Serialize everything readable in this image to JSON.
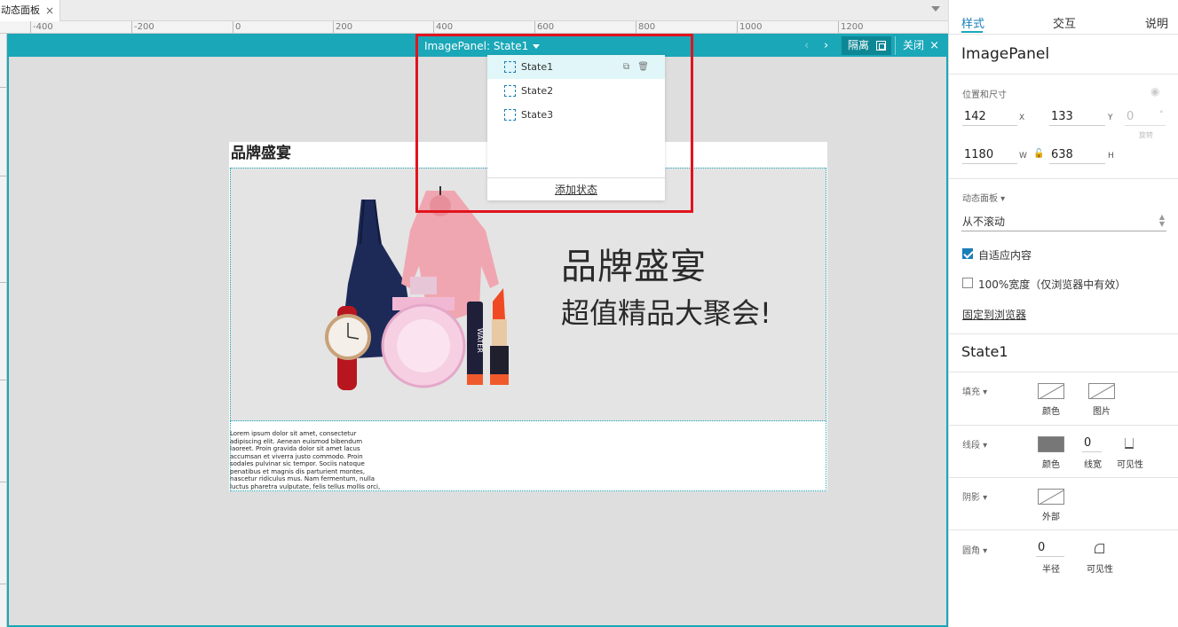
{
  "tab": {
    "label": "动态面板",
    "close": "×"
  },
  "ruler": {
    "ticks": [
      "-400",
      "-200",
      "0",
      "200",
      "400",
      "600",
      "800",
      "1000",
      "1200"
    ]
  },
  "panel": {
    "name_label": "ImagePanel:",
    "state": "State1",
    "prev": "‹",
    "next": "›",
    "isolate": "隔离",
    "close": "关闭",
    "close_x": "×"
  },
  "dropdown": {
    "states": [
      "State1",
      "State2",
      "State3"
    ],
    "add_state": "添加状态"
  },
  "design": {
    "title": "品牌盛宴",
    "headline": "品牌盛宴",
    "subline": "超值精品大聚会!",
    "lorem": "Lorem ipsum dolor sit amet, consectetur adipiscing elit. Aenean euismod bibendum laoreet. Proin gravida dolor sit amet lacus accumsan et viverra justo commodo. Proin sodales pulvinar sic tempor. Sociis natoque penatibus et magnis dis parturient montes, nascetur ridiculus mus. Nam fermentum, nulla luctus pharetra vulputate, felis tellus mollis orci, sed rhoncus pronin sapien nunc accuan eget.",
    "lipstick_text": "WATER"
  },
  "inspector": {
    "tabs": [
      "样式",
      "交互",
      "说明"
    ],
    "element_name": "ImagePanel",
    "pos_size_label": "位置和尺寸",
    "x": "142",
    "x_unit": "X",
    "y": "133",
    "y_unit": "Y",
    "rotation": "0",
    "rotation_unit": "°",
    "rotation_label": "旋转",
    "w": "1180",
    "w_unit": "W",
    "h": "638",
    "h_unit": "H",
    "dynamic_panel_label": "动态面板",
    "scroll_value": "从不滚动",
    "fit_content": "自适应内容",
    "full_width": "100%宽度（仅浏览器中有效）",
    "pin_browser": "固定到浏览器",
    "state_name": "State1",
    "fill_label": "填充",
    "fill_color": "颜色",
    "fill_image": "图片",
    "line_label": "线段",
    "line_color": "颜色",
    "line_width": "0",
    "line_width_label": "线宽",
    "line_visibility": "可见性",
    "shadow_label": "阴影",
    "shadow_outer": "外部",
    "corner_label": "圆角",
    "corner_radius": "0",
    "corner_radius_label": "半径",
    "corner_visibility": "可见性"
  },
  "colors": {
    "accent": "#1aa7b8",
    "highlight": "#e0141e",
    "link": "#1a7fb8"
  }
}
